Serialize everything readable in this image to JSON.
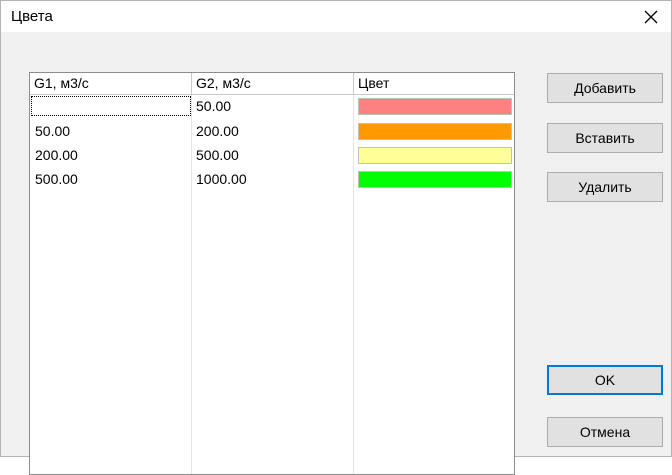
{
  "window": {
    "title": "Цвета"
  },
  "table": {
    "headers": [
      "G1, м3/с",
      "G2, м3/с",
      "Цвет"
    ],
    "rows": [
      {
        "g1": "",
        "g2": "50.00",
        "color": "#ff8080"
      },
      {
        "g1": "50.00",
        "g2": "200.00",
        "color": "#ff9900"
      },
      {
        "g1": "200.00",
        "g2": "500.00",
        "color": "#ffff99"
      },
      {
        "g1": "500.00",
        "g2": "1000.00",
        "color": "#00ff00"
      }
    ]
  },
  "buttons": {
    "add": "Добавить",
    "insert": "Вставить",
    "delete": "Удалить",
    "ok": "OK",
    "cancel": "Отмена"
  }
}
